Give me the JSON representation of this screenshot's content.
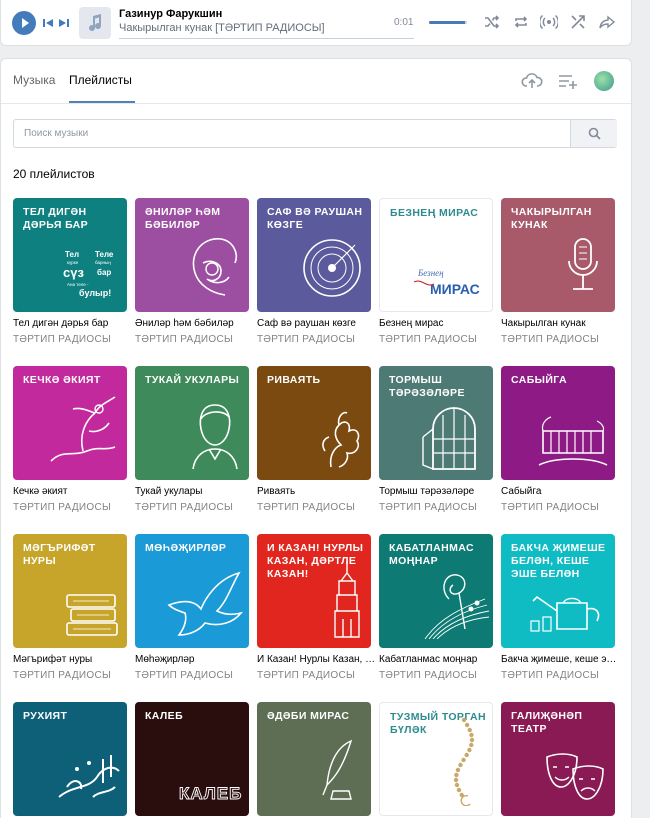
{
  "colors": {
    "accent": "#447bba",
    "tab_underline": "#5181b8"
  },
  "player": {
    "artist": "Газинур Фарукшин",
    "track": "Чакырылган кунак [ТӘРТИП РАДИОСЫ]",
    "time": "0:01",
    "volume_fraction": 0.95,
    "icons": [
      "play-icon",
      "previous-track-icon",
      "next-track-icon",
      "music-note-icon",
      "shuffle-icon",
      "repeat-icon",
      "broadcast-icon",
      "similar-icon",
      "share-icon"
    ]
  },
  "tabs": [
    {
      "label": "Музыка",
      "active": false
    },
    {
      "label": "Плейлисты",
      "active": true
    }
  ],
  "toolbar_icons": [
    "upload-icon",
    "add-playlist-icon",
    "profile-avatar-icon"
  ],
  "search": {
    "placeholder": "Поиск музыки",
    "value": ""
  },
  "playlists_count": "20 плейлистов",
  "playlists": [
    {
      "title": "Тел дигән дәрья бар",
      "subtitle": "ТӘРТИП РАДИОСЫ",
      "cover_text": "Тел дигән дәрья бар",
      "color": "#0e8080",
      "icon": "words-icon",
      "art_words": [
        "Тел",
        "Теле",
        "күрке",
        "барның",
        "сүз",
        "бар",
        "Ана теле -",
        "булыр!"
      ]
    },
    {
      "title": "Әниләр һәм бәбиләр",
      "subtitle": "ТӘРТИП РАДИОСЫ",
      "cover_text": "Әниләр һәм бәбиләр",
      "color": "#9c4fa0",
      "icon": "mother-child-icon"
    },
    {
      "title": "Саф вә раушан көзге",
      "subtitle": "ТӘРТИП РАДИОСЫ",
      "cover_text": "Саф вә раушан көзге",
      "color": "#5a5a9c",
      "icon": "vinyl-record-icon"
    },
    {
      "title": "Безнең мирас",
      "subtitle": "ТӘРТИП РАДИОСЫ",
      "cover_text": "Безнең мирас",
      "color": "#ffffff",
      "icon": "mirас-logo-icon",
      "light": true,
      "art_words": [
        "Безнең",
        "МИРАС"
      ]
    },
    {
      "title": "Чакырылган кунак",
      "subtitle": "ТӘРТИП РАДИОСЫ",
      "cover_text": "Чакырылган кунак",
      "color": "#a85a6a",
      "icon": "microphone-icon"
    },
    {
      "title": "Кечкә әкият",
      "subtitle": "ТӘРТИП РАДИОСЫ",
      "cover_text": "Кечкә әкият",
      "color": "#c2299c",
      "icon": "fairy-icon"
    },
    {
      "title": "Тукай укулары",
      "subtitle": "ТӘРТИП РАДИОСЫ",
      "cover_text": "Тукай укулары",
      "color": "#3e8a5a",
      "icon": "portrait-icon"
    },
    {
      "title": "Риваять",
      "subtitle": "ТӘРТИП РАДИОСЫ",
      "cover_text": "Риваять",
      "color": "#7a4a10",
      "icon": "dragon-icon"
    },
    {
      "title": "Тормыш тәрәзәләре",
      "subtitle": "ТӘРТИП РАДИОСЫ",
      "cover_text": "Тормыш тәрәзәләре",
      "color": "#4d7a74",
      "icon": "window-icon"
    },
    {
      "title": "Сабыйга",
      "subtitle": "ТӘРТИП РАДИОСЫ",
      "cover_text": "Сабыйга",
      "color": "#8e1a86",
      "icon": "cradle-icon"
    },
    {
      "title": "Мәгърифәт нуры",
      "subtitle": "ТӘРТИП РАДИОСЫ",
      "cover_text": "Мәгърифәт нуры",
      "color": "#c7a52a",
      "icon": "books-icon"
    },
    {
      "title": "Мөһәҗирләр",
      "subtitle": "ТӘРТИП РАДИОСЫ",
      "cover_text": "Мөһәҗирләр",
      "color": "#1a9ad6",
      "icon": "dove-icon"
    },
    {
      "title": "И Казан! Нурлы Казан, дәртле Казан!",
      "subtitle": "ТӘРТИП РАДИОСЫ",
      "cover_text": "И Казан! Нурлы Казан, дәртле Казан!",
      "color": "#e0261e",
      "icon": "tower-icon"
    },
    {
      "title": "Кабатланмас моңнар",
      "subtitle": "ТӘРТИП РАДИОСЫ",
      "cover_text": "Кабатланмас моңнар",
      "color": "#0d7a74",
      "icon": "music-staff-icon"
    },
    {
      "title": "Бакча җимеше, кеше эше белән",
      "subtitle": "ТӘРТИП РАДИОСЫ",
      "cover_text": "Бакча җимеше белән, кеше эше белән",
      "color": "#0fbcc4",
      "icon": "watering-can-icon"
    },
    {
      "title": "Рухият",
      "subtitle": "",
      "cover_text": "Рухият",
      "color": "#0e6078",
      "icon": "calligraphy-icon"
    },
    {
      "title": "Калеб",
      "subtitle": "",
      "cover_text": "Калеб",
      "color": "#2a0e0e",
      "icon": "kaleb-logo-icon",
      "art_words": [
        "КАЛЕБ"
      ]
    },
    {
      "title": "Әдәби мирас",
      "subtitle": "",
      "cover_text": "Әдәби мирас",
      "color": "#5e6e54",
      "icon": "quill-icon"
    },
    {
      "title": "Тузмый торган бүләк",
      "subtitle": "",
      "cover_text": "Тузмый торган бүләк",
      "color": "#ffffff",
      "icon": "prayer-beads-icon",
      "light": true
    },
    {
      "title": "Галиҗәнәп театр",
      "subtitle": "",
      "cover_text": "Галиҗәнәп театр",
      "color": "#8a1a54",
      "icon": "theatre-masks-icon"
    }
  ]
}
